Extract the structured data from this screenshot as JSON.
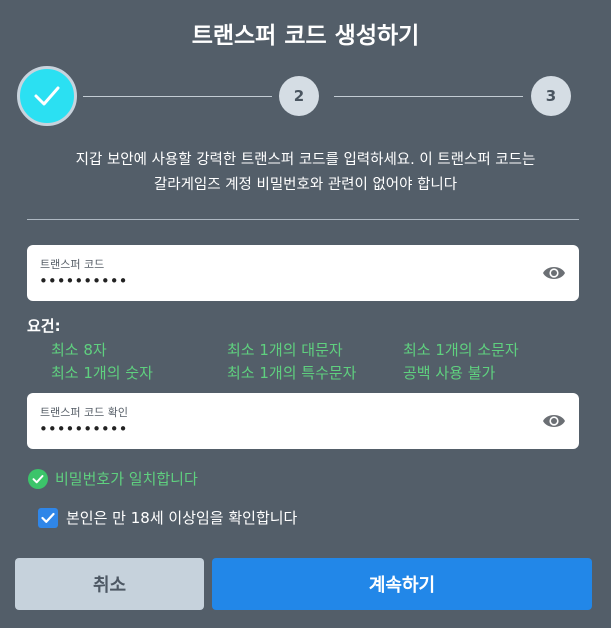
{
  "title": "트랜스퍼 코드 생성하기",
  "stepper": {
    "step2": "2",
    "step3": "3"
  },
  "description": {
    "line1": "지갑 보안에 사용할 강력한 트랜스퍼 코드를 입력하세요. 이 트랜스퍼 코드는",
    "line2": "갈라게임즈 계정 비밀번호와 관련이 없어야 합니다"
  },
  "transfer_code": {
    "label": "트랜스퍼 코드",
    "value": "••••••••••"
  },
  "requirements": {
    "title": "요건:",
    "items": [
      "최소 8자",
      "최소 1개의 대문자",
      "최소 1개의 소문자",
      "최소 1개의 숫자",
      "최소 1개의 특수문자",
      "공백 사용 불가"
    ]
  },
  "confirm_code": {
    "label": "트랜스퍼 코드 확인",
    "value": "••••••••••"
  },
  "match_message": "비밀번호가 일치합니다",
  "age_confirm": {
    "label": "본인은 만 18세 이상임을 확인합니다",
    "checked": true
  },
  "buttons": {
    "cancel": "취소",
    "continue": "계속하기"
  },
  "colors": {
    "background": "#535e69",
    "accent": "#2287e8",
    "success": "#5fd07f",
    "step_done": "#2be0f2"
  }
}
